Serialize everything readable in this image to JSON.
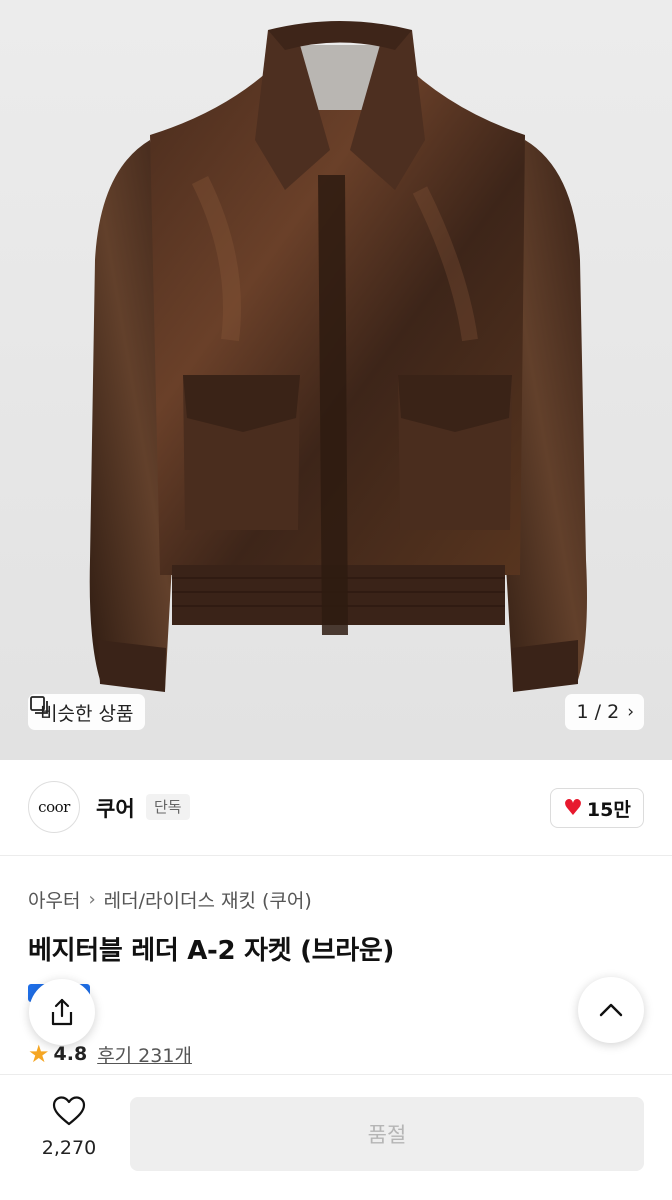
{
  "product_image": {
    "similar_label": "비슷한 상품",
    "pager": "1 / 2"
  },
  "brand": {
    "logo_text": "coor",
    "name": "쿠어",
    "tag": "단독",
    "likes": "15만"
  },
  "product": {
    "breadcrumb": [
      "아우터",
      "레더/라이더스 재킷 (쿠어)"
    ],
    "title": "베지터블 레더 A-2 자켓 (브라운)",
    "rating": "4.8",
    "reviews": "후기 231개"
  },
  "bottom_bar": {
    "wish_count": "2,270",
    "buy_label": "품절"
  },
  "colors": {
    "heart": "#e7192e",
    "star": "#f5a623",
    "badge_blue": "#1f6fe8",
    "leather_dark": "#3a2318",
    "leather_mid": "#5e3a26"
  }
}
